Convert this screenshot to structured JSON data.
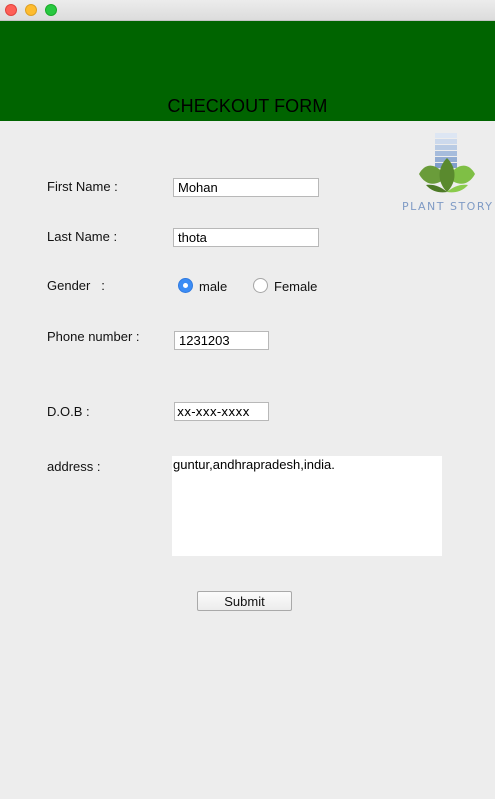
{
  "header": {
    "title": "CHECKOUT FORM"
  },
  "logo": {
    "text": "PLANT STORY"
  },
  "form": {
    "first_name": {
      "label": "First Name :",
      "value": "Mohan"
    },
    "last_name": {
      "label": "Last Name :",
      "value": "thota"
    },
    "gender": {
      "label": "Gender   :",
      "options": [
        {
          "label": "male",
          "selected": true
        },
        {
          "label": "Female",
          "selected": false
        }
      ]
    },
    "phone": {
      "label": "Phone number :",
      "value": "1231203"
    },
    "dob": {
      "label": "D.O.B :",
      "value": "xx-xxx-xxxx"
    },
    "address": {
      "label": "address :",
      "value": "guntur,andhrapradesh,india."
    },
    "submit_label": "Submit"
  },
  "colors": {
    "header_bg": "#006400",
    "radio_selected": "#3b8cf5",
    "logo_text": "#7f9bc5"
  }
}
